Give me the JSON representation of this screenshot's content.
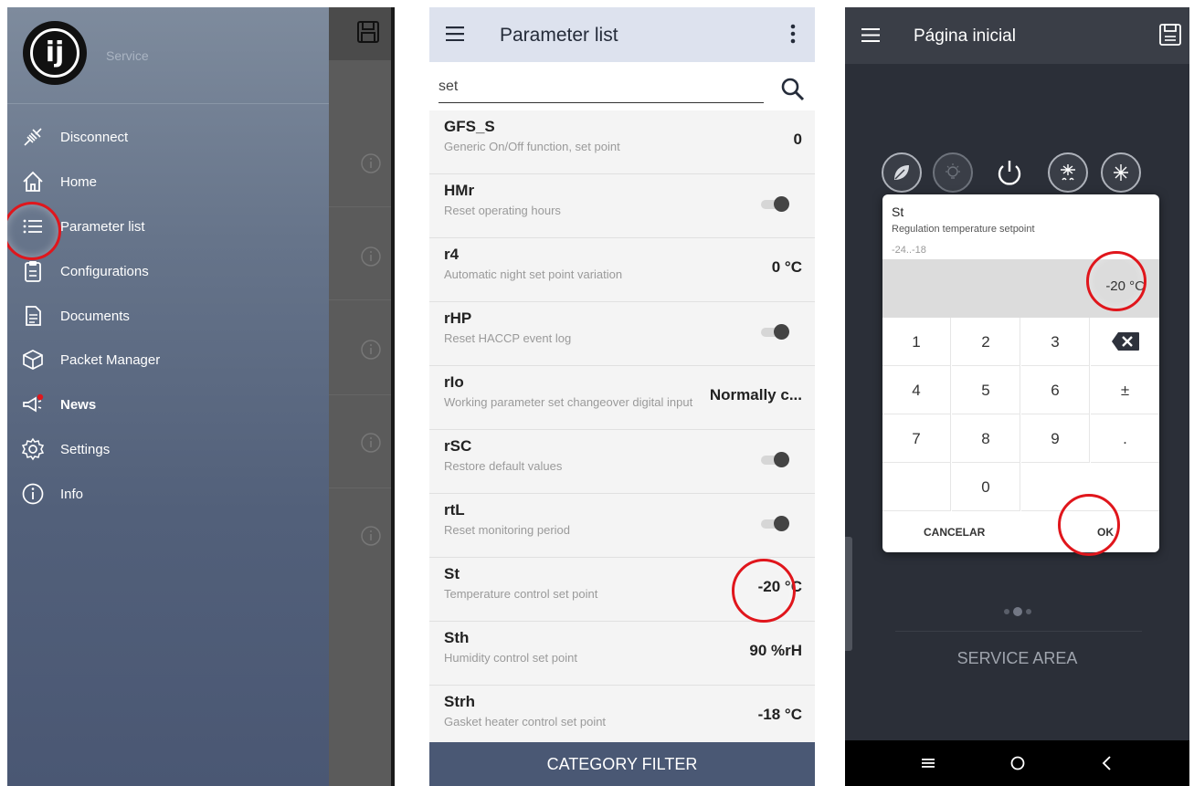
{
  "drawer_panel": {
    "header": {
      "logo_text": "ij",
      "subtitle": "Service"
    },
    "menu": [
      {
        "id": "disconnect",
        "label": "Disconnect",
        "icon": "plug-disconnect-icon",
        "bold": false
      },
      {
        "id": "home",
        "label": "Home",
        "icon": "home-icon",
        "bold": false
      },
      {
        "id": "parameter-list",
        "label": "Parameter list",
        "icon": "list-icon",
        "bold": false
      },
      {
        "id": "configurations",
        "label": "Configurations",
        "icon": "clipboard-icon",
        "bold": false
      },
      {
        "id": "documents",
        "label": "Documents",
        "icon": "document-icon",
        "bold": false
      },
      {
        "id": "packet-manager",
        "label": "Packet Manager",
        "icon": "package-icon",
        "bold": false
      },
      {
        "id": "news",
        "label": "News",
        "icon": "megaphone-icon",
        "bold": true
      },
      {
        "id": "settings",
        "label": "Settings",
        "icon": "gear-icon",
        "bold": false
      },
      {
        "id": "info",
        "label": "Info",
        "icon": "info-icon",
        "bold": false
      }
    ],
    "highlight_color": "#e0161c",
    "news_badge_color": "#e0161c"
  },
  "parameter_panel": {
    "title": "Parameter list",
    "search": {
      "value": "set",
      "placeholder": ""
    },
    "rows": [
      {
        "code": "GFS_S",
        "description": "Generic On/Off function, set point",
        "value": "0",
        "kind": "value"
      },
      {
        "code": "HMr",
        "description": "Reset operating hours",
        "value": "",
        "kind": "toggle"
      },
      {
        "code": "r4",
        "description": "Automatic night set point variation",
        "value": "0 °C",
        "kind": "value"
      },
      {
        "code": "rHP",
        "description": "Reset HACCP event log",
        "value": "",
        "kind": "toggle"
      },
      {
        "code": "rIo",
        "description": "Working parameter set changeover digital input",
        "value": "Normally c...",
        "kind": "value"
      },
      {
        "code": "rSC",
        "description": "Restore default values",
        "value": "",
        "kind": "toggle"
      },
      {
        "code": "rtL",
        "description": "Reset monitoring period",
        "value": "",
        "kind": "toggle"
      },
      {
        "code": "St",
        "description": "Temperature control set point",
        "value": "-20 °C",
        "kind": "value"
      },
      {
        "code": "Sth",
        "description": "Humidity control set point",
        "value": "90 %rH",
        "kind": "value"
      },
      {
        "code": "Strh",
        "description": "Gasket heater control set point",
        "value": "-18 °C",
        "kind": "value"
      }
    ],
    "category_filter_label": "CATEGORY FILTER",
    "colors": {
      "appbar": "#dde2ee",
      "footer": "#4a5874"
    }
  },
  "home_panel": {
    "title": "Página inicial",
    "mode_icons": [
      "leaf-icon",
      "lightbulb-icon",
      "power-icon",
      "defrost-icon",
      "snowflake-icon"
    ],
    "dialog": {
      "name": "St",
      "description": "Regulation temperature setpoint",
      "range": "-24..-18",
      "value": "-20 °C",
      "keys": [
        "1",
        "2",
        "3",
        "4",
        "5",
        "6",
        "7",
        "8",
        "9",
        "0",
        "±",
        "."
      ],
      "cancel_label": "CANCELAR",
      "ok_label": "OK"
    },
    "service_area_label": "SERVICE AREA"
  }
}
